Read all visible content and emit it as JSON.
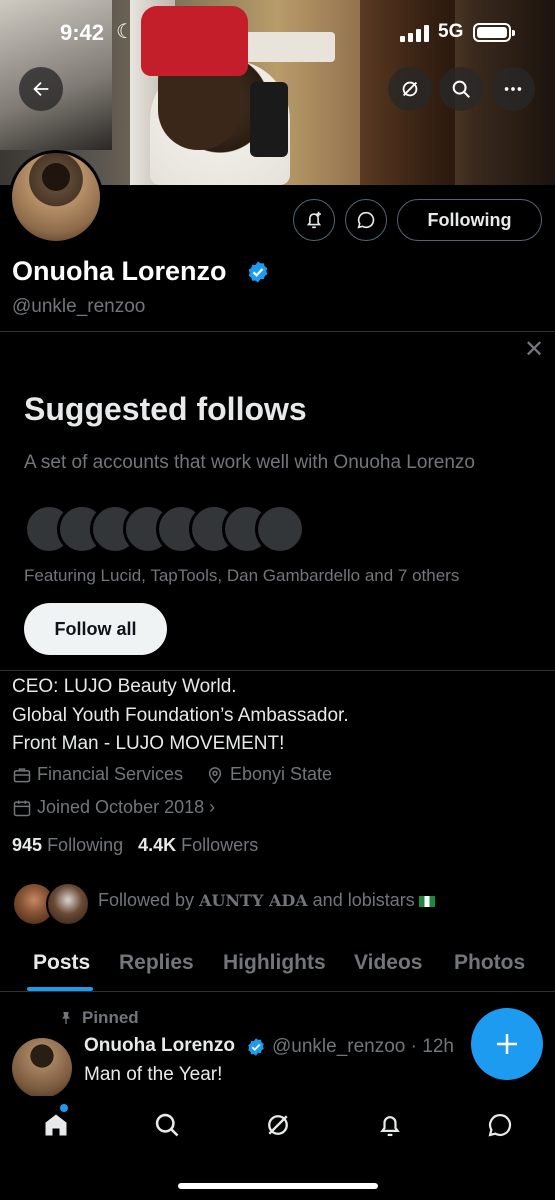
{
  "status_bar": {
    "time": "9:42",
    "network": "5G"
  },
  "profile": {
    "name": "Onuoha Lorenzo",
    "handle": "@unkle_renzoo",
    "following_button": "Following",
    "bio_lines": [
      "CEO: LUJO Beauty World.",
      "Global Youth Foundation’s Ambassador.",
      "Front Man - LUJO MOVEMENT!"
    ],
    "category": "Financial Services",
    "location": "Ebonyi State",
    "joined": "Joined October 2018",
    "following_count": "945",
    "following_label": "Following",
    "followers_count": "4.4K",
    "followers_label": "Followers",
    "followed_by_prefix": "Followed by",
    "followed_by_name1": "AUNTY ADA",
    "followed_by_and": "and",
    "followed_by_name2": "lobistars"
  },
  "suggested": {
    "title": "Suggested follows",
    "subtitle": "A set of accounts that work well with Onuoha Lorenzo",
    "featuring": "Featuring Lucid, TapTools, Dan Gambardello and 7 others",
    "follow_all": "Follow all"
  },
  "tabs": [
    "Posts",
    "Replies",
    "Highlights",
    "Videos",
    "Photos"
  ],
  "active_tab": "Posts",
  "pinned_post": {
    "pinned_label": "Pinned",
    "author": "Onuoha Lorenzo",
    "handle_time": "@unkle_renzoo · 12h",
    "text": "Man of the Year!"
  },
  "colors": {
    "accent": "#1d9bf0",
    "background": "#000000",
    "muted": "#71767b"
  },
  "icons": {
    "header": [
      "back-arrow-icon",
      "grok-icon",
      "search-icon",
      "more-icon"
    ],
    "actions": [
      "notification-add-icon",
      "message-icon"
    ],
    "nav": [
      "home-icon",
      "search-icon",
      "grok-icon",
      "bell-icon",
      "message-icon"
    ]
  }
}
